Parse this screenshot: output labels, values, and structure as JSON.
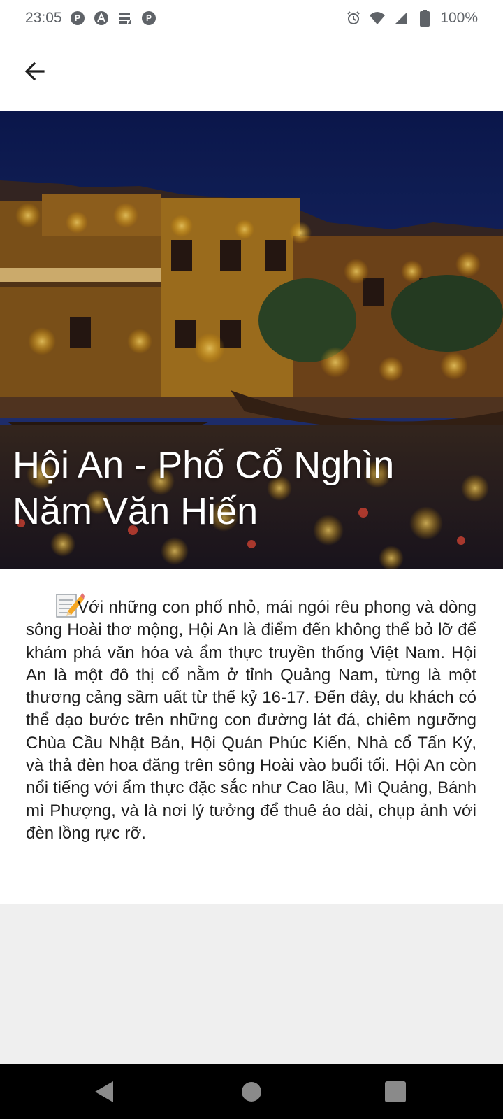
{
  "status_bar": {
    "time": "23:05",
    "battery": "100%",
    "left_icons": [
      "app-notification-icon",
      "app-a-icon",
      "storage-icon",
      "app-notification-icon"
    ],
    "right_icons": [
      "alarm-icon",
      "wifi-icon",
      "signal-icon",
      "battery-icon"
    ]
  },
  "app_bar": {
    "back_icon": "arrow-back-icon"
  },
  "hero": {
    "title": "Hội An - Phố Cổ Nghìn Năm Văn Hiến"
  },
  "article": {
    "emoji": "memo-pencil-icon",
    "body": "Với những con phố nhỏ, mái ngói rêu phong và dòng sông Hoài thơ mộng, Hội An là điểm đến không thể bỏ lỡ để khám phá văn hóa và ẩm thực truyền thống Việt Nam. Hội An là một đô thị cổ nằm ở tỉnh Quảng Nam, từng là một thương cảng sầm uất từ thế kỷ 16-17. Đến đây, du khách có thể dạo bước trên những con đường lát đá, chiêm ngưỡng Chùa Cầu Nhật Bản, Hội Quán Phúc Kiến, Nhà cổ Tấn Ký, và thả đèn hoa đăng trên sông Hoài vào buổi tối. Hội An còn nổi tiếng với ẩm thực đặc sắc như Cao lầu, Mì Quảng, Bánh mì Phượng, và là nơi lý tưởng để thuê áo dài, chụp ảnh với đèn lồng rực rỡ."
  },
  "nav_bar": {
    "buttons": [
      "back-triangle-icon",
      "home-circle-icon",
      "recents-square-icon"
    ]
  }
}
